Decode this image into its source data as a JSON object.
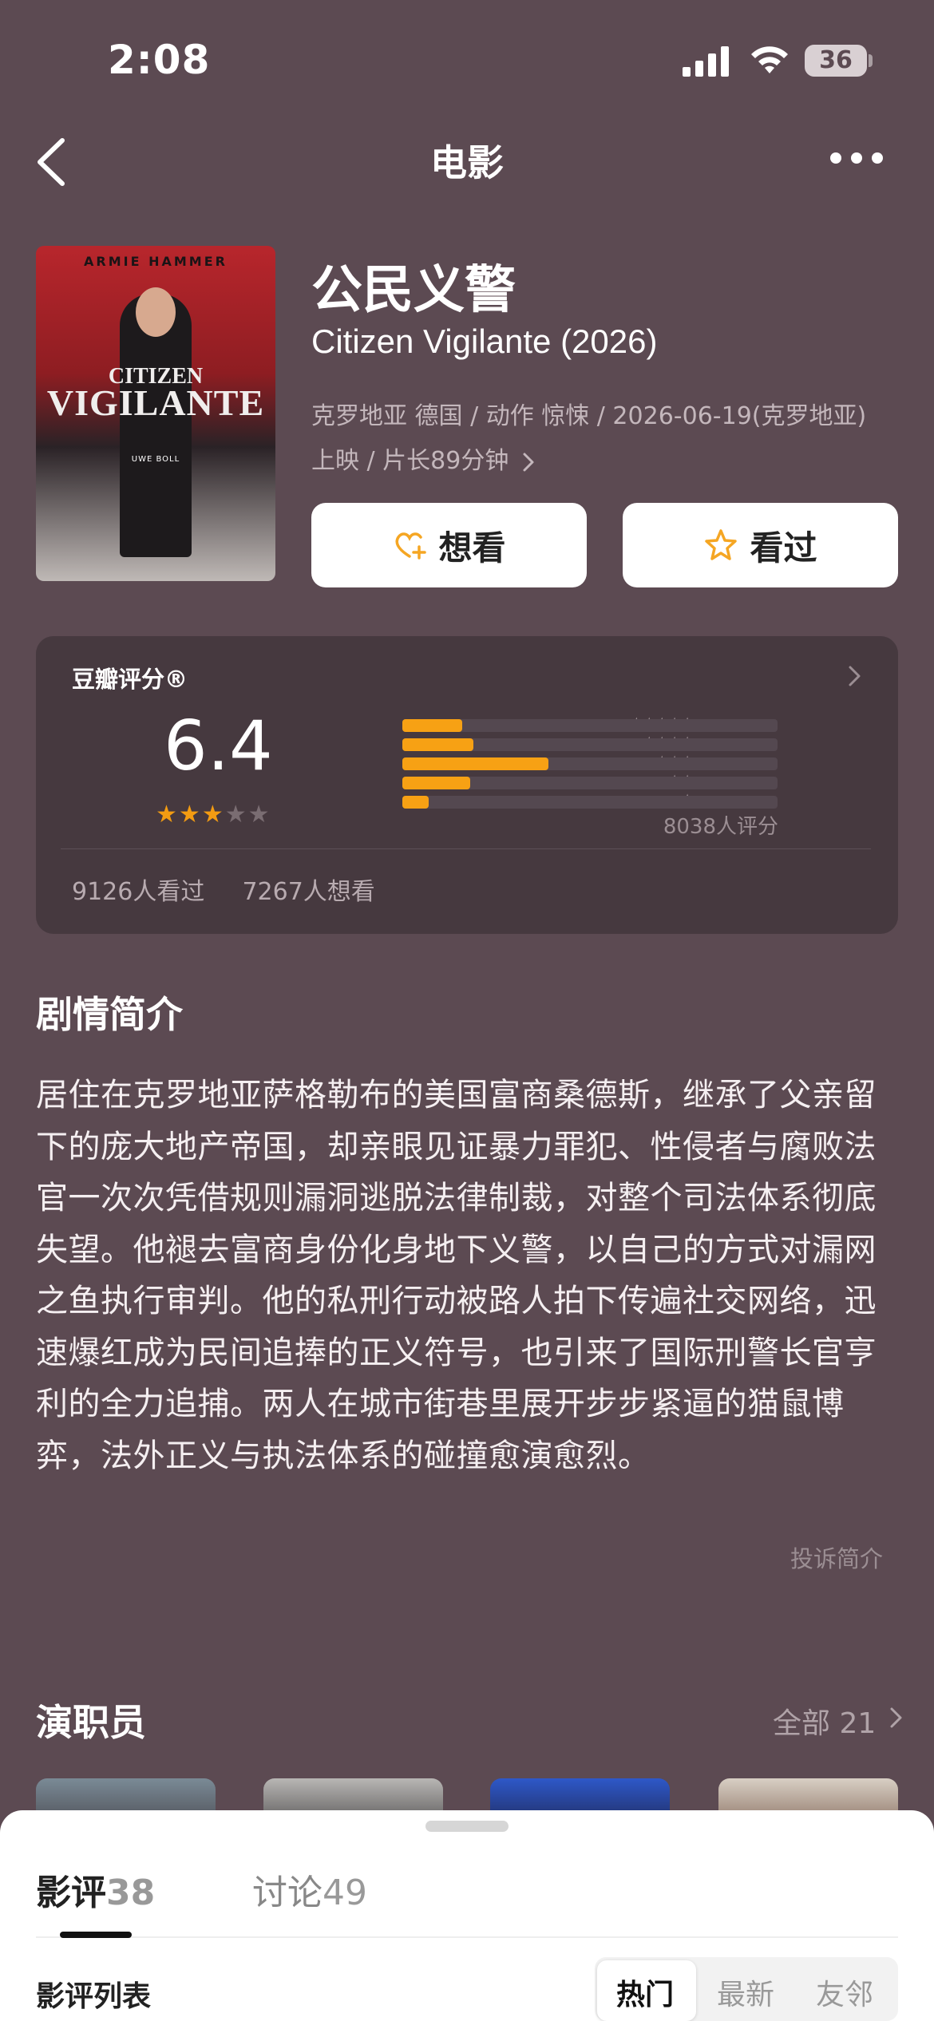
{
  "status_bar": {
    "time": "2:08",
    "battery": "36"
  },
  "nav": {
    "title": "电影"
  },
  "poster": {
    "actor": "ARMIE HAMMER",
    "title_line1": "CITIZEN",
    "title_line2": "VIGILANTE",
    "director_credit": "UWE BOLL"
  },
  "movie": {
    "title_cn": "公民义警",
    "title_en": "Citizen Vigilante (2026)",
    "meta": "克罗地亚 德国 / 动作 惊悚 / 2026-06-19(克罗地亚) 上映 / 片长89分钟"
  },
  "actions": {
    "want_label": "想看",
    "seen_label": "看过"
  },
  "rating": {
    "label": "豆瓣评分®",
    "score": "6.4",
    "stars_filled": 3,
    "stars_total": 5,
    "distribution": [
      {
        "stars": "★★★★★",
        "fraction": 0.16
      },
      {
        "stars": "★★★★",
        "fraction": 0.19
      },
      {
        "stars": "★★★",
        "fraction": 0.39
      },
      {
        "stars": "★★",
        "fraction": 0.18
      },
      {
        "stars": "★",
        "fraction": 0.07
      }
    ],
    "total": "8038人评分",
    "seen_count": "9126人看过",
    "want_count": "7267人想看",
    "colors": {
      "fill": "#f7a114",
      "star_on": "#f39c12"
    }
  },
  "synopsis": {
    "title": "剧情简介",
    "body": "居住在克罗地亚萨格勒布的美国富商桑德斯，继承了父亲留下的庞大地产帝国，却亲眼见证暴力罪犯、性侵者与腐败法官一次次凭借规则漏洞逃脱法律制裁，对整个司法体系彻底失望。他褪去富商身份化身地下义警，以自己的方式对漏网之鱼执行审判。他的私刑行动被路人拍下传遍社交网络，迅速爆红成为民间追捧的正义符号，也引来了国际刑警长官亨利的全力追捕。两人在城市街巷里展开步步紧逼的猫鼠博弈，法外正义与执法体系的碰撞愈演愈烈。",
    "report": "投诉简介"
  },
  "cast": {
    "title": "演职员",
    "all_label": "全部 21"
  },
  "sheet": {
    "tabs": [
      {
        "label": "影评",
        "count": "38"
      },
      {
        "label": "讨论",
        "count": "49"
      }
    ],
    "list_title": "影评列表",
    "sort_options": [
      "热门",
      "最新",
      "友邻"
    ]
  }
}
